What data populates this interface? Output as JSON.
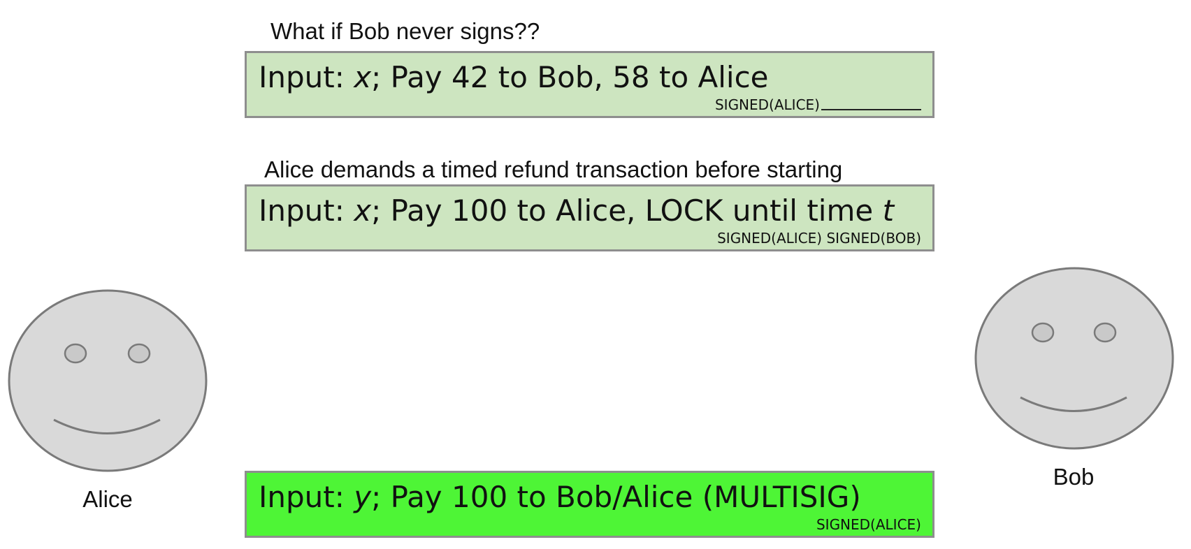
{
  "captions": {
    "question": "What if Bob never signs??",
    "refund_demand": "Alice demands a timed refund transaction before starting"
  },
  "transactions": [
    {
      "input_prefix": "Input: ",
      "input_var": "x",
      "description": "; Pay 42 to Bob, 58 to Alice",
      "signatures": "SIGNED(ALICE)",
      "signature_blank": true,
      "color": "#cde5c0"
    },
    {
      "input_prefix": "Input: ",
      "input_var": "x",
      "description": "; Pay 100 to Alice, LOCK until time ",
      "lock_var": "t",
      "signatures": "SIGNED(ALICE) SIGNED(BOB)",
      "color": "#cde5c0"
    },
    {
      "input_prefix": "Input: ",
      "input_var": "y",
      "description": "; Pay 100 to Bob/Alice (MULTISIG)",
      "signatures": "SIGNED(ALICE)",
      "color": "#4ef536"
    }
  ],
  "people": {
    "alice": {
      "name": "Alice",
      "icon": "smiley-face-icon"
    },
    "bob": {
      "name": "Bob",
      "icon": "smiley-face-icon"
    }
  },
  "colors": {
    "face_fill": "#d9d9d9",
    "face_stroke": "#7a7a7a",
    "box_border": "#8e8e8e"
  }
}
